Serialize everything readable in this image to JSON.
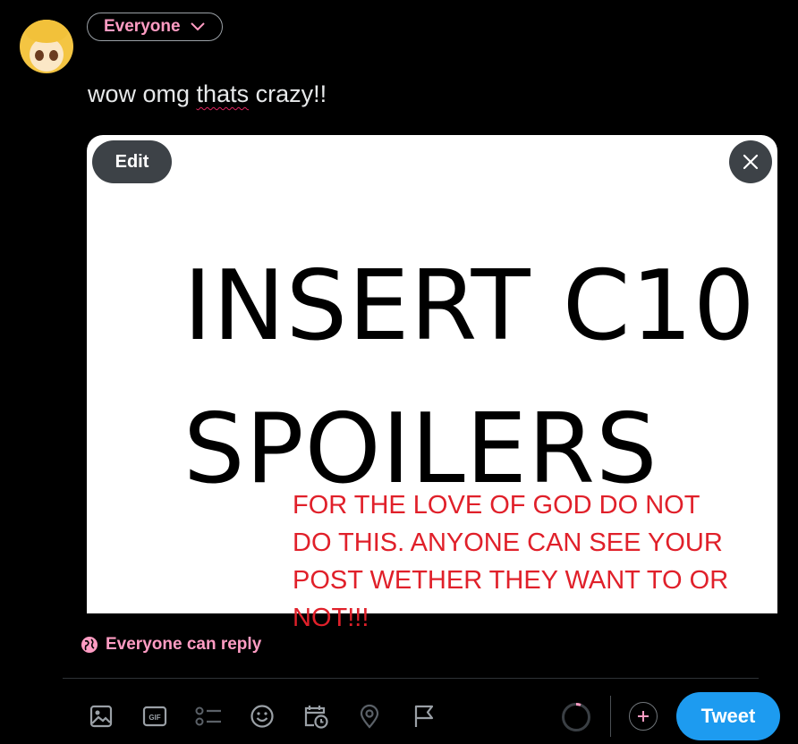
{
  "composer": {
    "audience_label": "Everyone",
    "text_before": "wow omg ",
    "text_misspelled": "thats",
    "text_after": " crazy!!"
  },
  "media": {
    "edit_label": "Edit",
    "image_text_line1": "INSERT C10",
    "image_text_line2": "SPOILERS",
    "overlay_text": "FOR THE LOVE OF GOD DO NOT\nDO THIS. ANYONE CAN SEE YOUR\nPOST WETHER THEY WANT TO OR\nNOT!!!"
  },
  "reply_setting": {
    "label": "Everyone can reply"
  },
  "toolbar": {
    "icons": [
      "image-icon",
      "gif-icon",
      "poll-icon",
      "emoji-icon",
      "schedule-icon",
      "location-icon",
      "flag-icon"
    ],
    "gif_label": "GIF"
  },
  "actions": {
    "tweet_label": "Tweet"
  },
  "colors": {
    "accent": "#1d9bf0",
    "pink": "#ff9cc3",
    "overlay_red": "#e0202a",
    "background": "#000000"
  }
}
